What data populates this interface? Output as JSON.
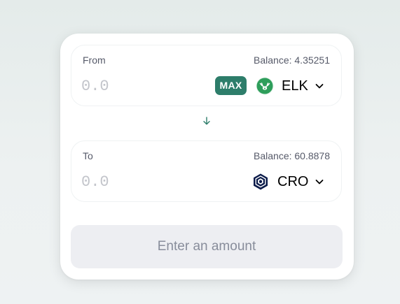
{
  "swap": {
    "from": {
      "label": "From",
      "balance": "Balance: 4.35251",
      "amount_placeholder": "0.0",
      "amount_value": "",
      "max_label": "MAX",
      "token": {
        "symbol": "ELK",
        "icon": "elk-icon",
        "icon_color": "#2e9e5b"
      }
    },
    "to": {
      "label": "To",
      "balance": "Balance: 60.8878",
      "amount_placeholder": "0.0",
      "amount_value": "",
      "token": {
        "symbol": "CRO",
        "icon": "cro-icon",
        "icon_color": "#0b1b4a"
      }
    },
    "switch_icon": "arrow-down-icon",
    "submit_label": "Enter an amount"
  },
  "colors": {
    "accent": "#2d7d6a",
    "disabled_button_bg": "#edeef2",
    "disabled_button_text": "#888d9b",
    "placeholder": "#c3c5cb"
  }
}
